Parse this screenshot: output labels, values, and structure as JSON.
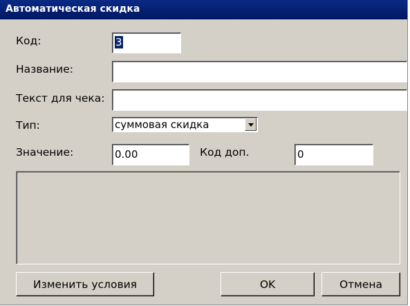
{
  "window": {
    "title": "Автоматическая скидка"
  },
  "form": {
    "code_label": "Код:",
    "code_value": "3",
    "name_label": "Название:",
    "name_value": "",
    "receipt_label": "Текст для чека:",
    "receipt_value": "",
    "type_label": "Тип:",
    "type_value": "суммовая скидка",
    "value_label": "Значение:",
    "value_value": "0.00",
    "extra_code_label": "Код доп.",
    "extra_code_value": "0"
  },
  "buttons": {
    "change_conditions": "Изменить условия",
    "ok": "OK",
    "cancel": "Отмена"
  }
}
